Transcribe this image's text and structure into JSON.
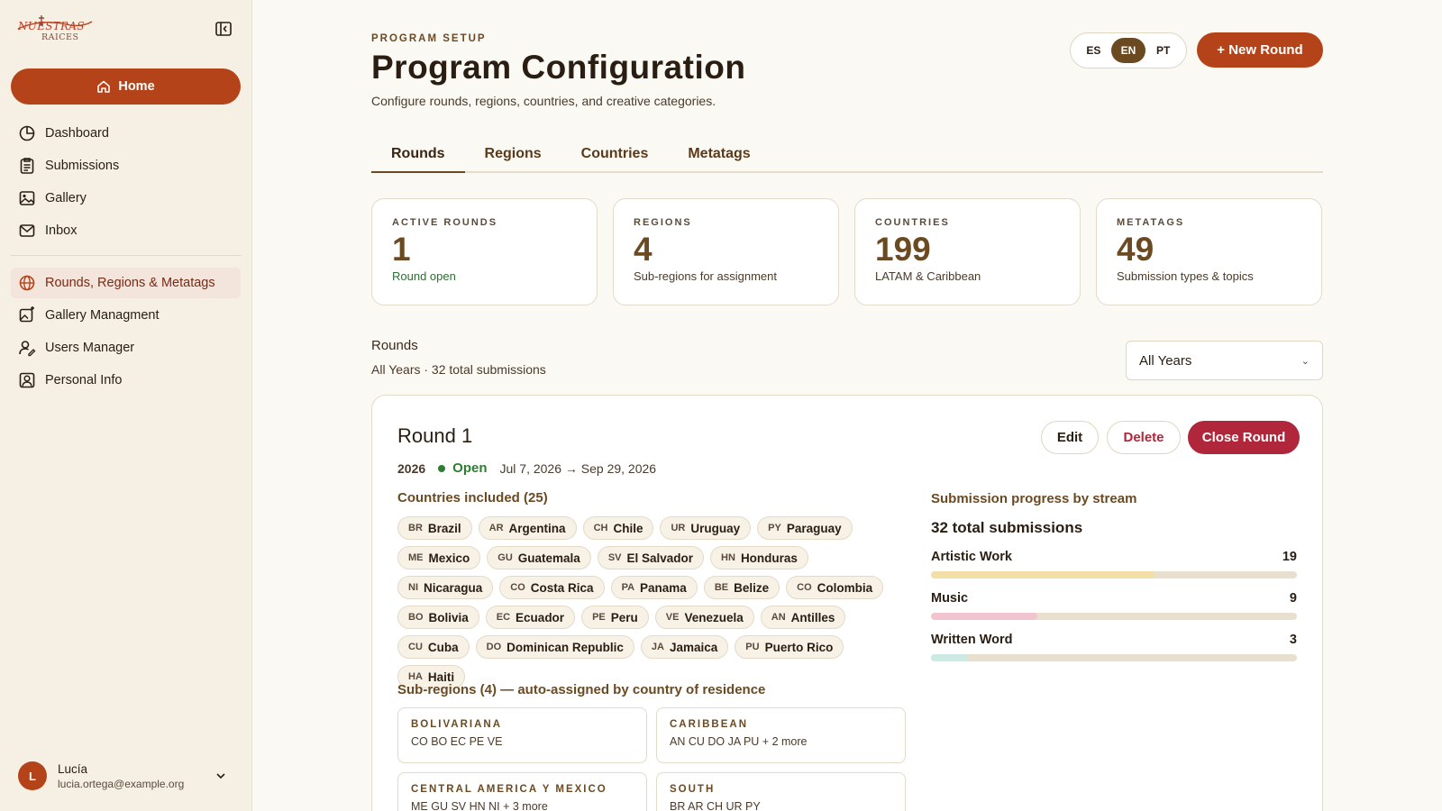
{
  "brand": {
    "logo_line1": "NUESTRAS",
    "logo_line2": "RAICES"
  },
  "sidebar": {
    "home_label": "Home",
    "items": [
      {
        "label": "Dashboard",
        "icon": "pie-chart-icon"
      },
      {
        "label": "Submissions",
        "icon": "clipboard-icon"
      },
      {
        "label": "Gallery",
        "icon": "image-icon"
      },
      {
        "label": "Inbox",
        "icon": "mail-icon"
      }
    ],
    "admin_items": [
      {
        "label": "Rounds, Regions & Metatags",
        "icon": "globe-icon",
        "active": true
      },
      {
        "label": "Gallery Managment",
        "icon": "image-edit-icon"
      },
      {
        "label": "Users Manager",
        "icon": "user-edit-icon"
      },
      {
        "label": "Personal Info",
        "icon": "user-square-icon"
      }
    ],
    "user": {
      "initial": "L",
      "name": "Lucía",
      "email": "lucia.ortega@example.org"
    }
  },
  "header": {
    "eyebrow": "PROGRAM SETUP",
    "title": "Program Configuration",
    "subtitle": "Configure rounds, regions, countries, and creative categories.",
    "languages": [
      "ES",
      "EN",
      "PT"
    ],
    "active_language": "EN",
    "new_round_label": "+ New Round"
  },
  "tabs": [
    "Rounds",
    "Regions",
    "Countries",
    "Metatags"
  ],
  "active_tab": "Rounds",
  "stats": [
    {
      "label": "ACTIVE ROUNDS",
      "value": "1",
      "note": "Round open",
      "note_color": "#2e6e34"
    },
    {
      "label": "REGIONS",
      "value": "4",
      "note": "Sub-regions for assignment"
    },
    {
      "label": "COUNTRIES",
      "value": "199",
      "note": "LATAM & Caribbean"
    },
    {
      "label": "METATAGS",
      "value": "49",
      "note": "Submission types & topics"
    }
  ],
  "rounds_section": {
    "heading": "Rounds",
    "summary": "All Years · 32 total submissions",
    "year_filter": "All Years"
  },
  "round": {
    "title": "Round 1",
    "year": "2026",
    "status": "Open",
    "dates": "Jul 7, 2026 → Sep 29, 2026",
    "edit_label": "Edit",
    "delete_label": "Delete",
    "close_label": "Close Round",
    "countries_heading": "Countries included (25)",
    "countries": [
      {
        "code": "BR",
        "name": "Brazil"
      },
      {
        "code": "AR",
        "name": "Argentina"
      },
      {
        "code": "CH",
        "name": "Chile"
      },
      {
        "code": "UR",
        "name": "Uruguay"
      },
      {
        "code": "PY",
        "name": "Paraguay"
      },
      {
        "code": "ME",
        "name": "Mexico"
      },
      {
        "code": "GU",
        "name": "Guatemala"
      },
      {
        "code": "SV",
        "name": "El Salvador"
      },
      {
        "code": "HN",
        "name": "Honduras"
      },
      {
        "code": "NI",
        "name": "Nicaragua"
      },
      {
        "code": "CO",
        "name": "Costa Rica"
      },
      {
        "code": "PA",
        "name": "Panama"
      },
      {
        "code": "BE",
        "name": "Belize"
      },
      {
        "code": "CO",
        "name": "Colombia"
      },
      {
        "code": "BO",
        "name": "Bolivia"
      },
      {
        "code": "EC",
        "name": "Ecuador"
      },
      {
        "code": "PE",
        "name": "Peru"
      },
      {
        "code": "VE",
        "name": "Venezuela"
      },
      {
        "code": "AN",
        "name": "Antilles"
      },
      {
        "code": "CU",
        "name": "Cuba"
      },
      {
        "code": "DO",
        "name": "Dominican Republic"
      },
      {
        "code": "JA",
        "name": "Jamaica"
      },
      {
        "code": "PU",
        "name": "Puerto Rico"
      },
      {
        "code": "HA",
        "name": "Haiti"
      }
    ],
    "subregions_heading": "Sub-regions (4) — auto-assigned by country of residence",
    "subregions": [
      {
        "name": "BOLIVARIANA",
        "codes": "CO BO EC PE VE"
      },
      {
        "name": "CARIBBEAN",
        "codes": "AN CU DO JA PU + 2 more"
      },
      {
        "name": "CENTRAL AMERICA Y MEXICO",
        "codes": "ME GU SV HN NI + 3 more"
      },
      {
        "name": "SOUTH",
        "codes": "BR AR CH UR PY"
      }
    ],
    "progress_heading": "Submission progress by stream",
    "progress_total": "32 total submissions",
    "streams": [
      {
        "name": "Artistic Work",
        "count": "19",
        "fraction": 0.61,
        "color": "#f3dfa6"
      },
      {
        "name": "Music",
        "count": "9",
        "fraction": 0.29,
        "color": "#f2c4cf"
      },
      {
        "name": "Written Word",
        "count": "3",
        "fraction": 0.1,
        "color": "#cce9e4"
      }
    ]
  }
}
